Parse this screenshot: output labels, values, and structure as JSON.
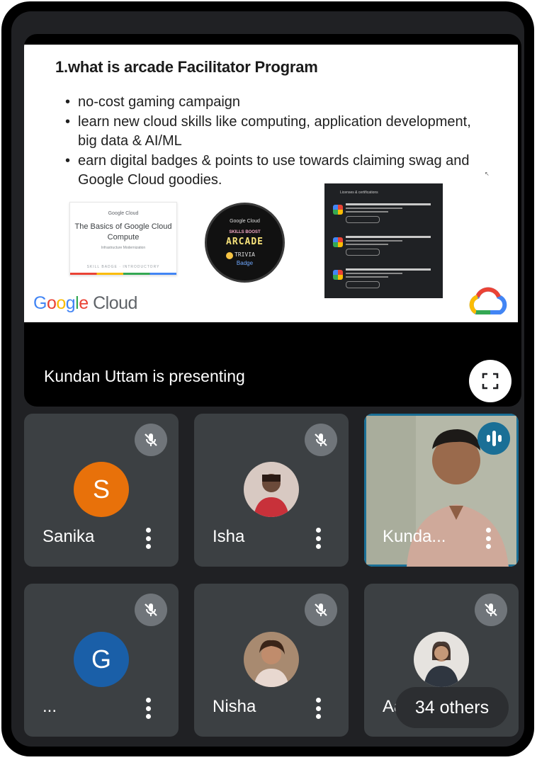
{
  "slide": {
    "title": "1.what is arcade Facilitator Program",
    "bullets": [
      "no-cost gaming campaign",
      "learn new cloud skills like computing, application development, big data & AI/ML",
      "earn digital badges & points to use towards claiming swag and Google Cloud goodies."
    ],
    "card_brand": "Google Cloud",
    "card_title": "The Basics of Google Cloud Compute",
    "card_sub": "Infrastructure Modernization",
    "card_footer": "SKILL BADGE · INTRODUCTORY",
    "badge_brand": "Google Cloud",
    "badge_line1": "SKILLS BOOST",
    "badge_line2": "ARCADE",
    "badge_line3": "TRIVIA",
    "badge_line4": "Badge",
    "certs_header": "Licenses & certifications",
    "footer_logo_google": "Google",
    "footer_logo_cloud": "Cloud"
  },
  "presenting_text": "Kundan Uttam is presenting",
  "fullscreen_icon": "fullscreen-icon",
  "participants": [
    {
      "name": "Sanika",
      "initial": "S",
      "avatar_color": "#e8710a",
      "muted": true
    },
    {
      "name": "Isha",
      "muted": true
    },
    {
      "name": "Kunda...",
      "muted": false,
      "speaking": true
    },
    {
      "name": "...",
      "initial": "G",
      "avatar_color": "#1a5fa8",
      "muted": true
    },
    {
      "name": "Nisha",
      "muted": true
    },
    {
      "name": "Aa",
      "muted": true
    }
  ],
  "others_label": "34 others",
  "colors": {
    "background": "#202124",
    "tile": "#3c4043",
    "speaking_ring": "#1a6f96",
    "mute_badge": "#70757a"
  }
}
